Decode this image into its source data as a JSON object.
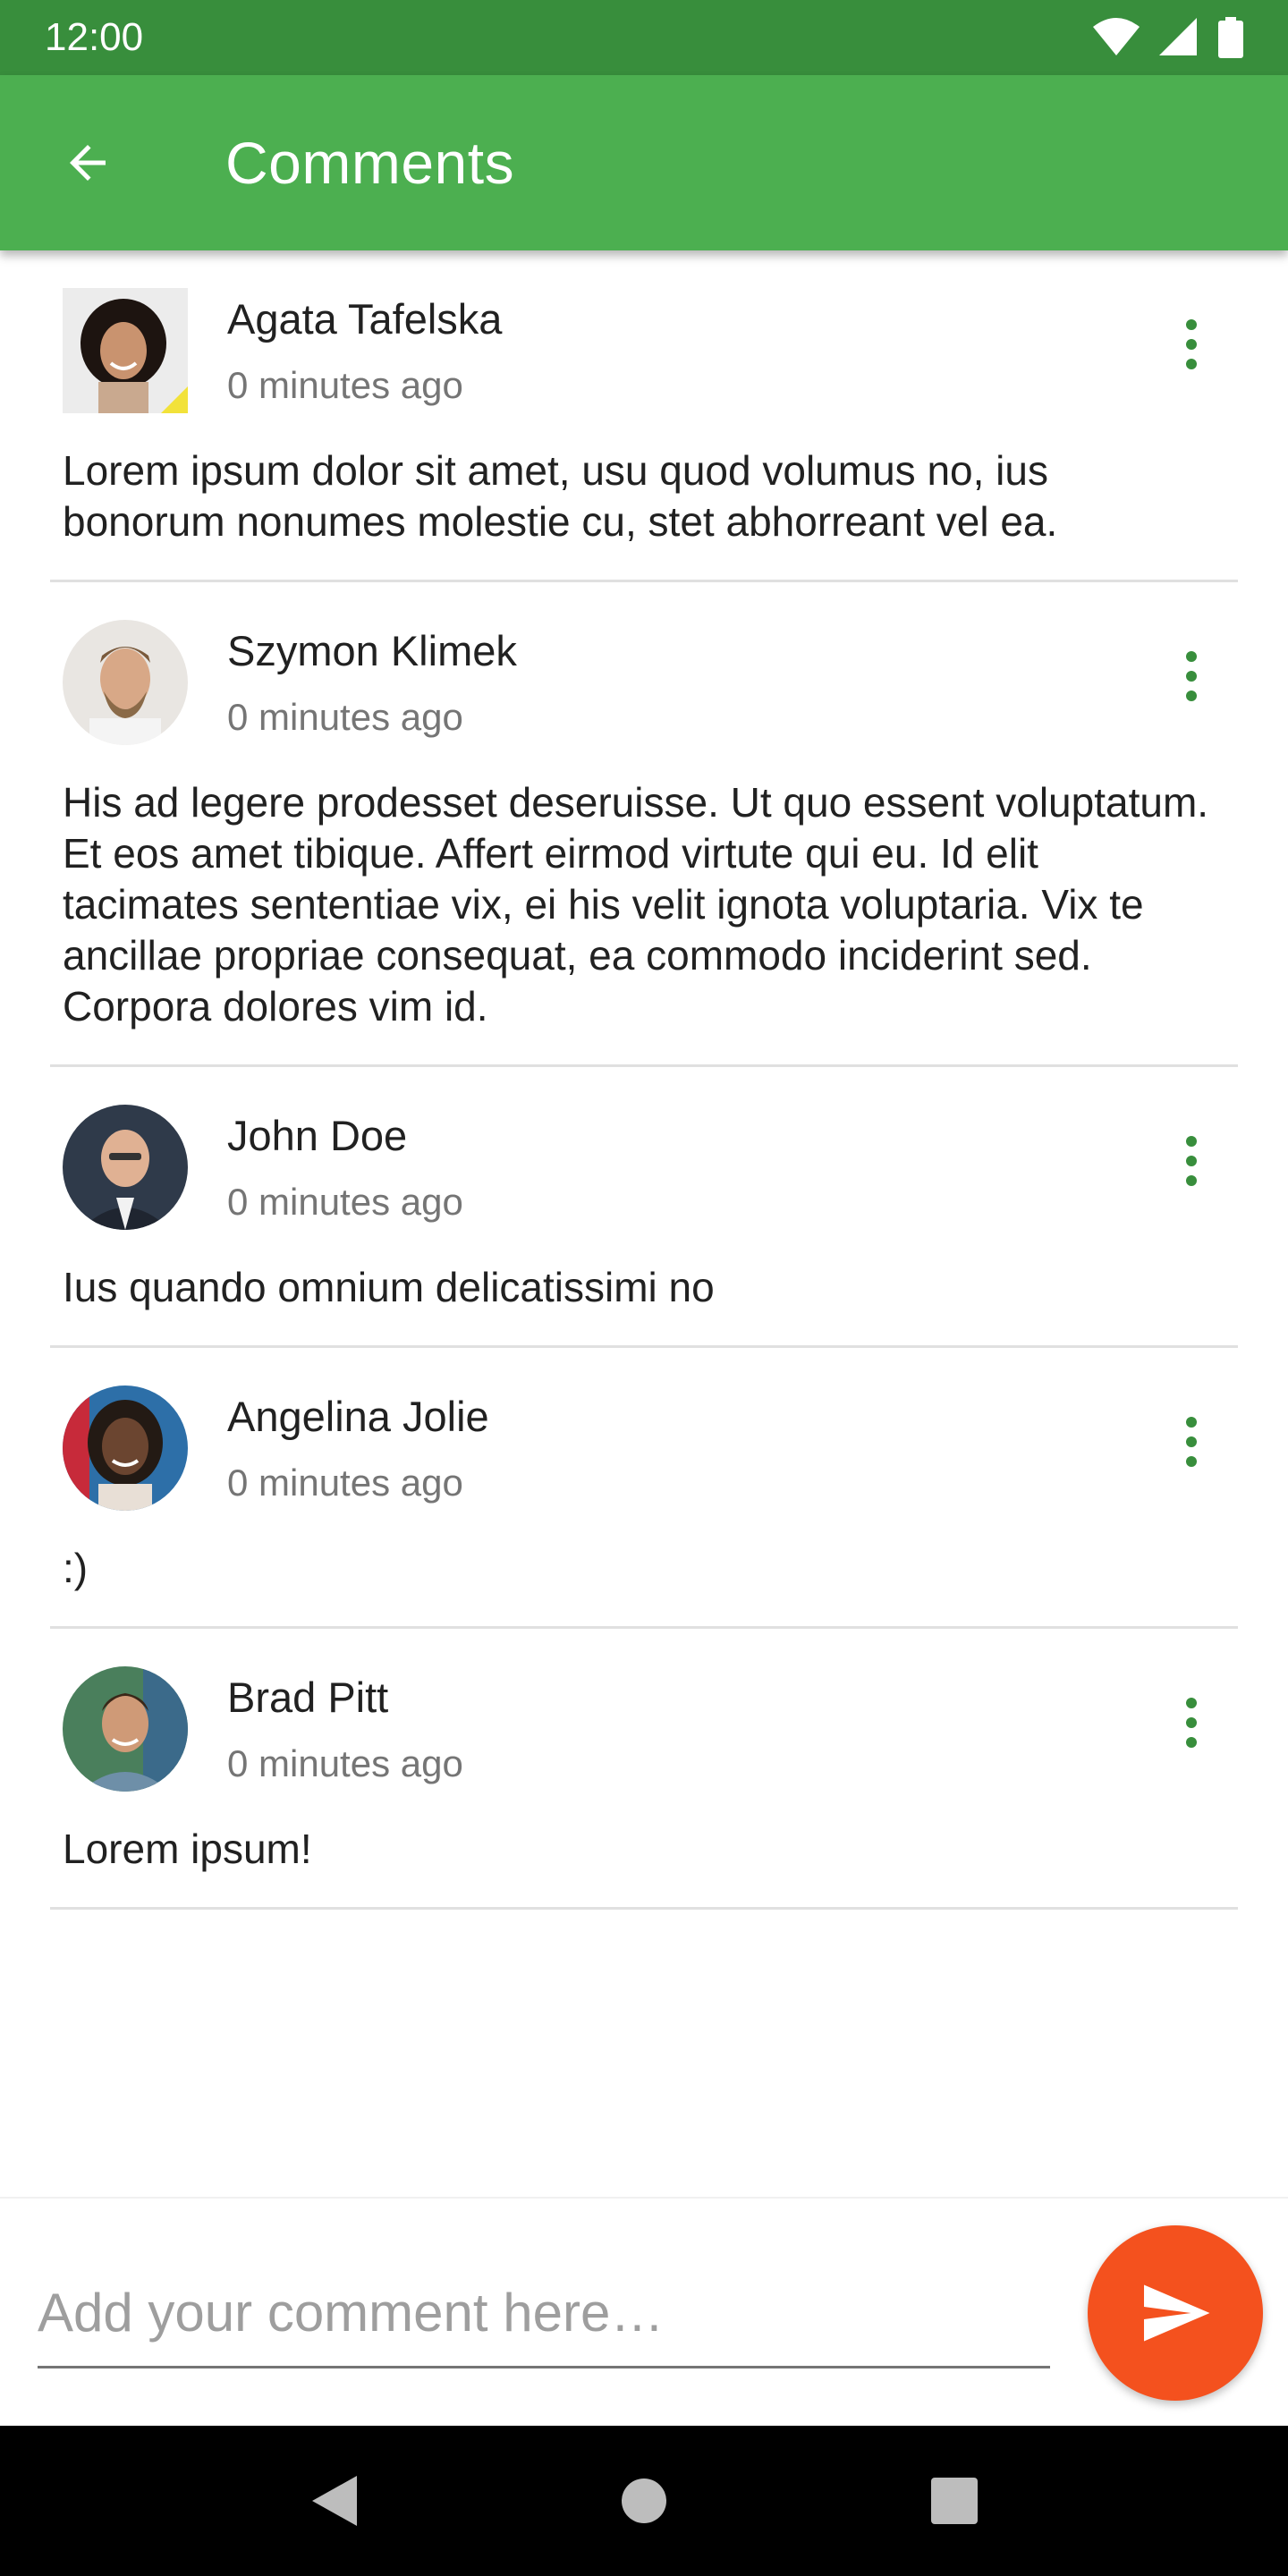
{
  "status_bar": {
    "time": "12:00",
    "icons": [
      "wifi-icon",
      "signal-icon",
      "battery-icon"
    ]
  },
  "app_bar": {
    "title": "Comments",
    "back_icon": "arrow-back-icon"
  },
  "comments": [
    {
      "author": "Agata Tafelska",
      "time": "0 minutes ago",
      "text": "Lorem ipsum dolor sit amet, usu quod volumus no, ius bonorum nonumes molestie cu, stet abhorreant vel ea."
    },
    {
      "author": "Szymon Klimek",
      "time": "0 minutes ago",
      "text": "His ad legere prodesset deseruisse. Ut quo essent voluptatum. Et eos amet tibique. Affert eirmod virtute qui eu. Id elit tacimates sententiae vix, ei his velit ignota voluptaria. Vix te ancillae propriae consequat, ea commodo inciderint sed. Corpora dolores vim id."
    },
    {
      "author": "John Doe",
      "time": "0 minutes ago",
      "text": "Ius quando omnium delicatissimi no"
    },
    {
      "author": "Angelina Jolie",
      "time": "0 minutes ago",
      "text": ":)"
    },
    {
      "author": "Brad Pitt",
      "time": "0 minutes ago",
      "text": "Lorem ipsum!"
    }
  ],
  "composer": {
    "placeholder": "Add your comment here…",
    "value": "",
    "send_icon": "send-icon"
  },
  "navigation": {
    "icons": [
      "nav-back-icon",
      "nav-home-icon",
      "nav-recents-icon"
    ]
  },
  "colors": {
    "status_bar": "#388e3c",
    "app_bar": "#4caf50",
    "accent": "#f4511e",
    "menu_dots": "#388e3c"
  }
}
